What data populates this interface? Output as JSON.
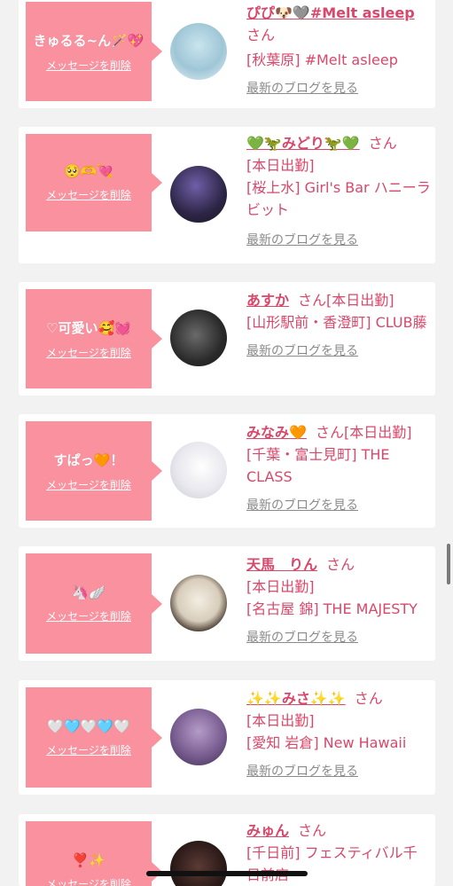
{
  "common": {
    "delete_label": "メッセージを削除",
    "blog_label": "最新のブログを見る",
    "san": "さん"
  },
  "colors": {
    "accent_pink": "#f9919f",
    "link_pink": "#d9476a",
    "muted_gray": "#8a8a8a"
  },
  "cards": [
    {
      "message": "きゅるる~ん🪄💖",
      "name": "ぴぴ🐶🩶#Melt asleep",
      "status": "",
      "shop": "[秋葉原] #Melt asleep"
    },
    {
      "message": "🥺🫶💘",
      "name": "💚🦖みどり🦖💚",
      "status": "[本日出勤]",
      "shop": "[桜上水] Girl's Bar ハニーラビット"
    },
    {
      "message": "♡可愛い🥰💓",
      "name": "あすか",
      "status": "[本日出勤]",
      "shop": "[山形駅前・香澄町] CLUB藤"
    },
    {
      "message": "すぱっ🧡！",
      "name": "みなみ🧡",
      "status": "[本日出勤]",
      "shop": "[千葉・富士見町] THE CLASS"
    },
    {
      "message": "🦄🪽",
      "name": "天馬　りん",
      "status": "[本日出勤]",
      "shop": "[名古屋 錦] THE MAJESTY"
    },
    {
      "message": "🤍🩵🤍🩵🤍",
      "name": "✨✨みさ✨✨",
      "status": "[本日出勤]",
      "shop": "[愛知 岩倉] New Hawaii"
    },
    {
      "message": "❣️✨",
      "name": "みゅん",
      "status": "",
      "shop": "[千日前] フェスティバル千日前店"
    }
  ]
}
